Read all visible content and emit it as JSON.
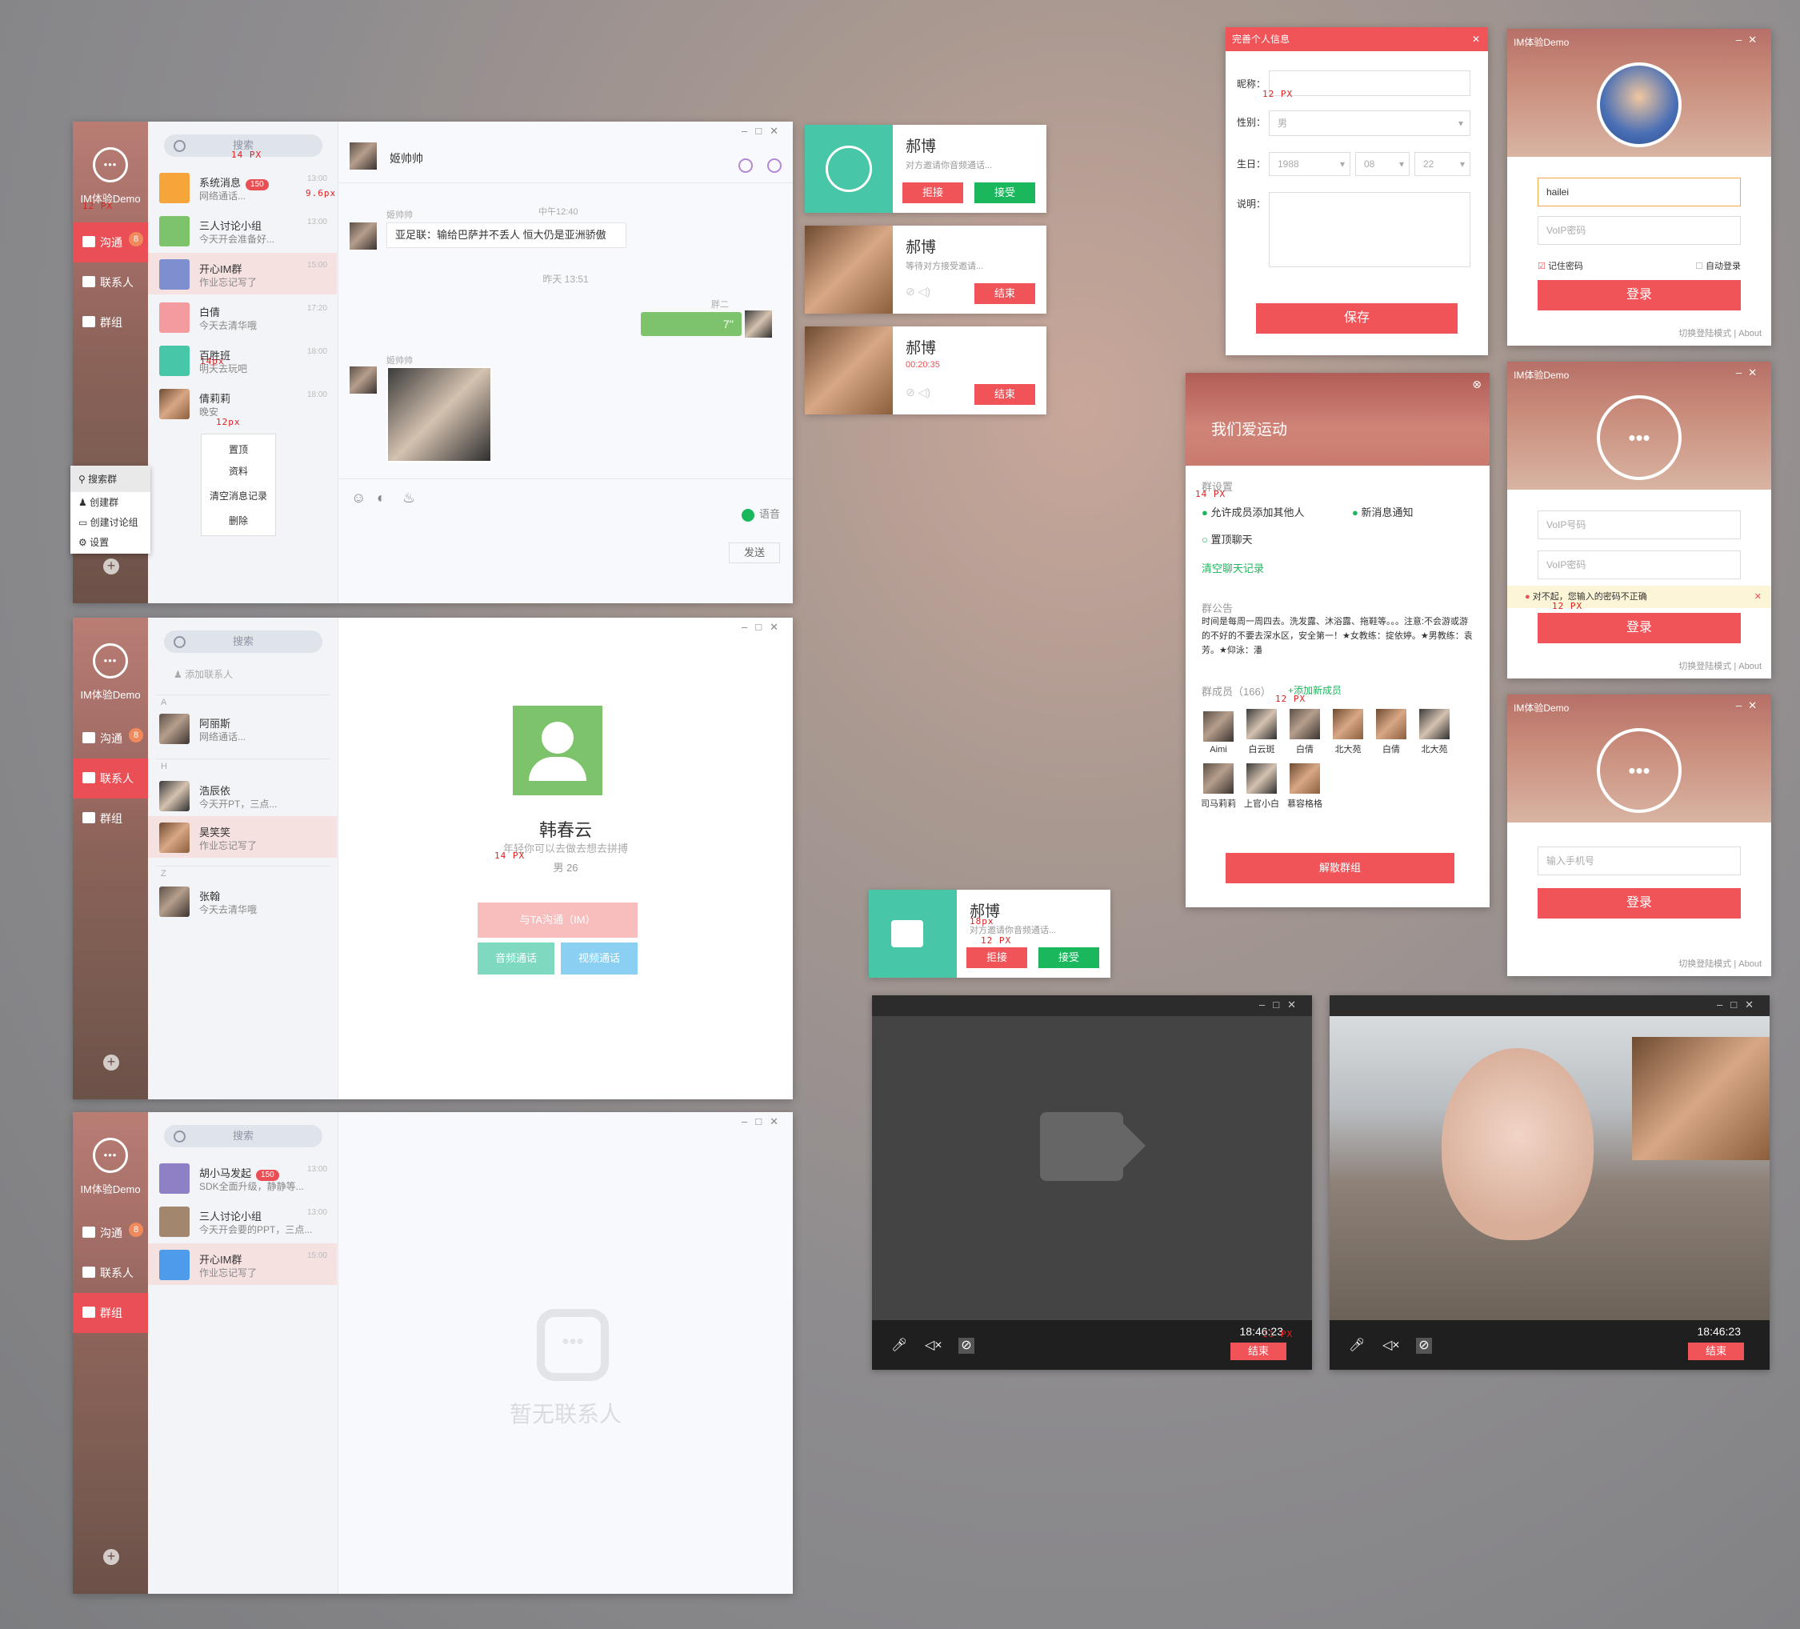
{
  "app": {
    "brand": "IM体验Demo",
    "nav": {
      "chat": "沟通",
      "contacts": "联系人",
      "groups": "群组",
      "badge": "8"
    },
    "search": "搜索"
  },
  "chat_list": [
    {
      "name": "系统消息",
      "sub": "网络通话...",
      "time": "13:00",
      "badge": "150"
    },
    {
      "name": "三人讨论小组",
      "sub": "今天开会准备好...",
      "time": "13:00"
    },
    {
      "name": "开心IM群",
      "sub": "作业忘记写了",
      "time": "15:00"
    },
    {
      "name": "白倩",
      "sub": "今天去清华哦",
      "time": "17:20"
    },
    {
      "name": "百胜班",
      "sub": "明天去玩吧",
      "time": "18:00"
    },
    {
      "name": "倩莉莉",
      "sub": "晚安",
      "time": "18:00"
    }
  ],
  "context_menu": [
    "置顶",
    "资料",
    "清空消息记录",
    "删除"
  ],
  "plus_menu": [
    "搜索群",
    "创建群",
    "创建讨论组",
    "设置"
  ],
  "conversation": {
    "title": "姬帅帅",
    "msg_sender": "姬帅帅",
    "msg_time": "中午12:40",
    "msg_text": "亚足联：输给巴萨并不丢人 恒大仍是亚洲骄傲",
    "divider": "昨天 13:51",
    "voice_sender": "胖二",
    "voice_len": "7''",
    "img_sender": "姬帅帅",
    "voice_btn": "语音",
    "send_btn": "发送"
  },
  "contacts": {
    "add": "添加联系人",
    "groups": [
      {
        "letter": "A",
        "items": [
          {
            "name": "阿丽斯",
            "sub": "网络通话..."
          }
        ]
      },
      {
        "letter": "H",
        "items": [
          {
            "name": "浩辰依",
            "sub": "今天开PT，三点..."
          },
          {
            "name": "昊笑笑",
            "sub": "作业忘记写了"
          }
        ]
      },
      {
        "letter": "Z",
        "items": [
          {
            "name": "张翰",
            "sub": "今天去清华哦"
          }
        ]
      }
    ]
  },
  "profile": {
    "name": "韩春云",
    "motto": "年轻你可以去做去想去拼搏",
    "gender_age": "男  26",
    "im_btn": "与TA沟通（IM）",
    "audio_btn": "音频通话",
    "video_btn": "视频通话"
  },
  "group_list": [
    {
      "name": "胡小马发起",
      "sub": "SDK全面升级，静静等...",
      "time": "13:00",
      "badge": "150"
    },
    {
      "name": "三人讨论小组",
      "sub": "今天开会要的PPT，三点...",
      "time": "13:00"
    },
    {
      "name": "开心IM群",
      "sub": "作业忘记写了",
      "time": "15:00"
    }
  ],
  "empty_text": "暂无联系人",
  "calls": {
    "voice_invite": {
      "name": "郝博",
      "sub": "对方邀请你音频通话...",
      "reject": "拒接",
      "accept": "接受"
    },
    "waiting": {
      "name": "郝博",
      "sub": "等待对方接受邀请...",
      "end": "结束"
    },
    "in_call": {
      "name": "郝博",
      "time": "00:20:35",
      "end": "结束"
    },
    "video_invite": {
      "name": "郝博",
      "sub": "对方邀请你音频通话...",
      "reject": "拒接",
      "accept": "接受"
    }
  },
  "profile_form": {
    "title": "完善个人信息",
    "nickname": "昵称：",
    "gender": "性别：",
    "gender_val": "男",
    "birth": "生日：",
    "year": "1988",
    "month": "08",
    "day": "22",
    "desc": "说明：",
    "save": "保存"
  },
  "group_settings": {
    "title": "我们爱运动",
    "settings": "群设置",
    "opt1": "允许成员添加其他人",
    "opt2": "新消息通知",
    "opt3": "置顶聊天",
    "clear": "清空聊天记录",
    "notice_title": "群公告",
    "notice": "时间是每周一周四去。洗发露、沐浴露、拖鞋等。。。注意:不会游或游的不好的不要去深水区，安全第一！★女教练：掟依婷。★男教练：袁芳。★仰泳：潘",
    "members_label": "群成员（166）",
    "add_member": "添加新成员",
    "members": [
      "Aimi",
      "白云斑",
      "白倩",
      "北大苑",
      "白倩",
      "北大苑",
      "司马莉莉",
      "上官小白",
      "慕容格格"
    ],
    "dismiss": "解散群组"
  },
  "login1": {
    "title": "IM体验Demo",
    "user": "hailei",
    "pwd": "VoIP密码",
    "remember": "记住密码",
    "auto": "自动登录",
    "login": "登录",
    "switch": "切换登陆模式",
    "about": "About"
  },
  "login2": {
    "title": "IM体验Demo",
    "id": "VoIP号码",
    "pwd": "VoIP密码",
    "error": "对不起，您输入的密码不正确",
    "login": "登录",
    "switch": "切换登陆模式",
    "about": "About"
  },
  "login3": {
    "title": "IM体验Demo",
    "phone": "输入手机号",
    "login": "登录",
    "switch": "切换登陆模式",
    "about": "About"
  },
  "video": {
    "time1": "18:46:23",
    "time2": "18:46:23",
    "end": "结束"
  },
  "specs": {
    "px14": "14 PX",
    "px12": "12 PX",
    "px96": "9.6px",
    "px12l": "12px",
    "px14l": "14px",
    "px18": "18px",
    "px11": "11 PX"
  },
  "colors": {
    "accent": "#e94f55",
    "green": "#1bb75c",
    "teal": "#47c6a8"
  }
}
